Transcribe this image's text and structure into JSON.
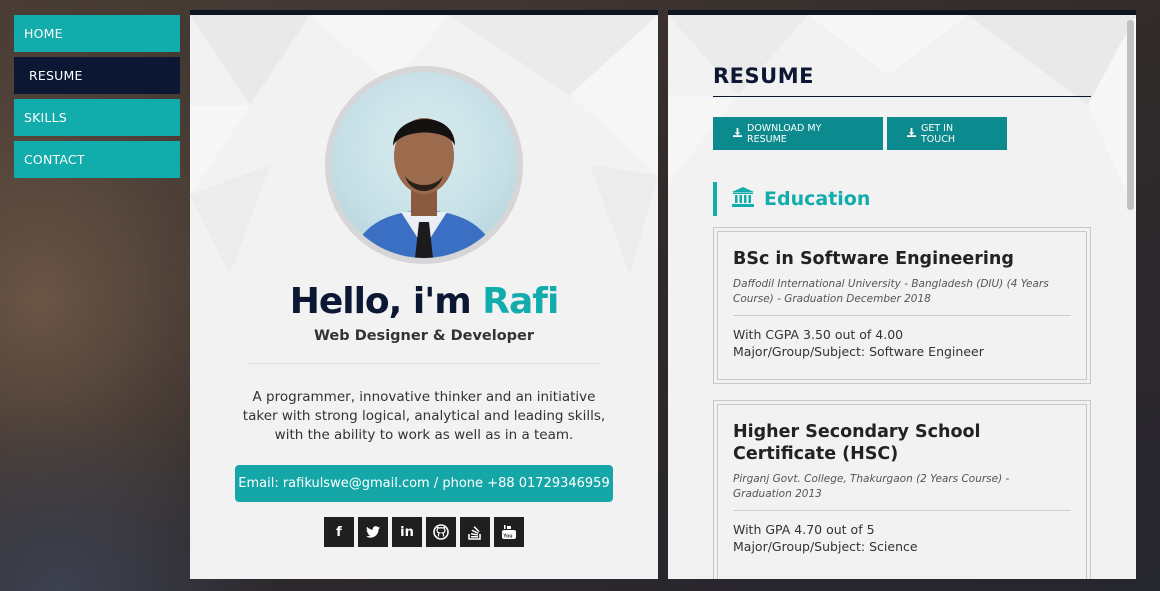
{
  "nav": {
    "items": [
      {
        "label": "HOME"
      },
      {
        "label": "RESUME"
      },
      {
        "label": "SKILLS"
      },
      {
        "label": "CONTACT"
      }
    ]
  },
  "profile": {
    "greeting": "Hello, i'm ",
    "name": "Rafi",
    "subtitle": "Web Designer & Developer",
    "bio": "A programmer, innovative thinker and an initiative taker with strong logical, analytical and leading skills, with the ability to work as well as in a team.",
    "contact": "Email: rafikulswe@gmail.com / phone +88 01729346959",
    "socials": [
      {
        "icon": "facebook-icon",
        "glyph": "f"
      },
      {
        "icon": "twitter-icon",
        "glyph": "🐦"
      },
      {
        "icon": "linkedin-icon",
        "glyph": "in"
      },
      {
        "icon": "github-icon",
        "glyph": "⌾"
      },
      {
        "icon": "stackoverflow-icon",
        "glyph": "≡"
      },
      {
        "icon": "youtube-icon",
        "glyph": "▶"
      }
    ]
  },
  "resume": {
    "title": "RESUME",
    "download_label": "DOWNLOAD MY RESUME",
    "touch_label": "GET IN TOUCH",
    "education_label": "Education",
    "education": [
      {
        "title": "BSc in Software Engineering",
        "sub": "Daffodil International University - Bangladesh (DIU) (4 Years Course) - Graduation December 2018",
        "line1": "With CGPA 3.50 out of 4.00",
        "line2": "Major/Group/Subject: Software Engineer"
      },
      {
        "title": "Higher Secondary School Certificate (HSC)",
        "sub": "Pirganj Govt. College, Thakurgaon (2 Years Course) - Graduation 2013",
        "line1": "With GPA 4.70 out of 5",
        "line2": "Major/Group/Subject: Science"
      }
    ]
  },
  "colors": {
    "accent": "#12acad",
    "navy": "#0c1833"
  }
}
